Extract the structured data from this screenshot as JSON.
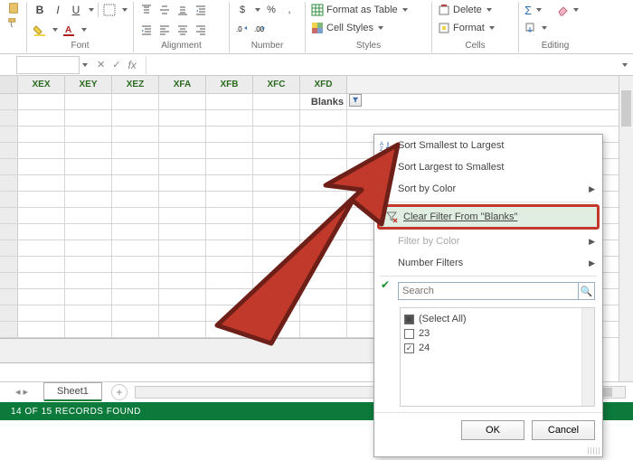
{
  "ribbon": {
    "font": {
      "label": "Font",
      "bold": "B",
      "italic": "I",
      "underline": "U"
    },
    "alignment": {
      "label": "Alignment"
    },
    "number": {
      "label": "Number",
      "currency": "$",
      "percent": "%",
      "comma": ","
    },
    "styles": {
      "label": "Styles",
      "format_as_table": "Format as Table",
      "cell_styles": "Cell Styles"
    },
    "cells": {
      "label": "Cells",
      "delete": "Delete",
      "format": "Format"
    },
    "editing": {
      "label": "Editing"
    }
  },
  "formula_bar": {
    "fx": "fx",
    "cancel": "✕",
    "confirm": "✓",
    "dropdown": "▾"
  },
  "columns": [
    "XEX",
    "XEY",
    "XEZ",
    "XFA",
    "XFB",
    "XFC",
    "XFD"
  ],
  "header_cell": {
    "label": "Blanks"
  },
  "sheet": {
    "tab": "Sheet1",
    "new": "+"
  },
  "status": {
    "text": "14 OF 15 RECORDS FOUND"
  },
  "filter_menu": {
    "sort_asc": "Sort Smallest to Largest",
    "sort_desc": "Sort Largest to Smallest",
    "sort_color": "Sort by Color",
    "clear_filter": "Clear Filter From \"Blanks\"",
    "filter_color": "Filter by Color",
    "number_filters": "Number Filters",
    "search_placeholder": "Search",
    "select_all": "(Select All)",
    "values": [
      "23",
      "24"
    ],
    "ok": "OK",
    "cancel": "Cancel"
  }
}
